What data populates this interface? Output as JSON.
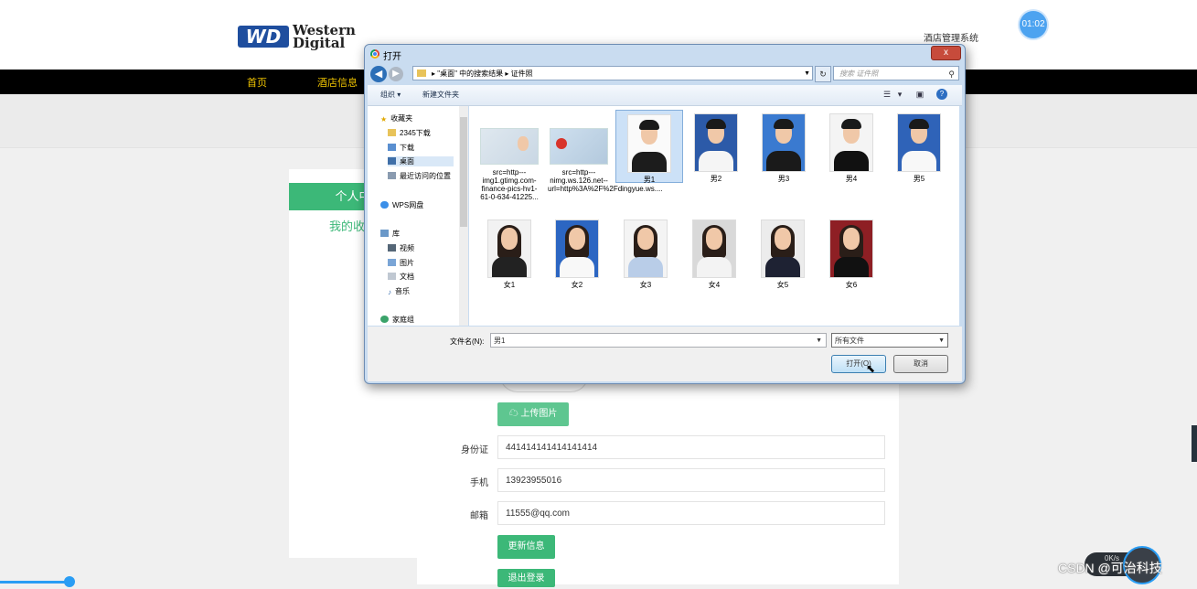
{
  "header": {
    "logo_mark": "WD",
    "logo_line1": "Western",
    "logo_line2": "Digital",
    "system_title": "酒店管理系统",
    "clock": "01:02"
  },
  "nav": {
    "items": [
      {
        "label": "首页"
      },
      {
        "label": "酒店信息"
      }
    ]
  },
  "sidebar": {
    "heading": "个人中",
    "link": "我的收"
  },
  "form": {
    "upload_label": "上传图片",
    "id_label": "身份证",
    "id_value": "441414141414141414",
    "phone_label": "手机",
    "phone_value": "13923955016",
    "email_label": "邮箱",
    "email_value": "11555@qq.com",
    "update_label": "更新信息",
    "logout_label": "退出登录"
  },
  "dialog": {
    "title": "打开",
    "close": "x",
    "address": "▸  \"桌面\" 中的搜索结果  ▸  证件照",
    "search_placeholder": "搜索 证件照",
    "toolbar": {
      "organize": "组织 ▾",
      "new_folder": "新建文件夹"
    },
    "nav_pane": [
      {
        "label": "收藏夹",
        "icon": "star-icon"
      },
      {
        "label": "2345下载",
        "icon": "folder-icon"
      },
      {
        "label": "下载",
        "icon": "download-folder-icon"
      },
      {
        "label": "桌面",
        "icon": "desktop-icon"
      },
      {
        "label": "最近访问的位置",
        "icon": "recent-icon"
      },
      {
        "label": "WPS网盘",
        "icon": "cloud-icon"
      },
      {
        "label": "库",
        "icon": "library-icon"
      },
      {
        "label": "视频",
        "icon": "video-icon"
      },
      {
        "label": "图片",
        "icon": "picture-icon"
      },
      {
        "label": "文档",
        "icon": "document-icon"
      },
      {
        "label": "音乐",
        "icon": "music-icon"
      },
      {
        "label": "家庭组",
        "icon": "homegroup-icon"
      }
    ],
    "files_row1": [
      {
        "label": "src=http---img1.gtimg.com-finance-pics-hv1-61-0-634-41225...",
        "kind": "idcard"
      },
      {
        "label": "src=http---nimg.ws.126.net--url=http%3A%2F%2Fdingyue.ws....",
        "kind": "idcard"
      },
      {
        "label": "男1",
        "kind": "male"
      },
      {
        "label": "男2",
        "kind": "male"
      },
      {
        "label": "男3",
        "kind": "male"
      },
      {
        "label": "男4",
        "kind": "male"
      },
      {
        "label": "男5",
        "kind": "male"
      }
    ],
    "files_row2": [
      {
        "label": "女1",
        "kind": "female"
      },
      {
        "label": "女2",
        "kind": "female"
      },
      {
        "label": "女3",
        "kind": "female"
      },
      {
        "label": "女4",
        "kind": "female"
      },
      {
        "label": "女5",
        "kind": "female"
      },
      {
        "label": "女6",
        "kind": "female"
      }
    ],
    "filename_label": "文件名(N):",
    "filename_value": "男1",
    "filetype_value": "所有文件",
    "open_label": "打开(O)",
    "cancel_label": "取消"
  },
  "watermark": "CSDN @可治科技",
  "speed_widget": "0K/s"
}
